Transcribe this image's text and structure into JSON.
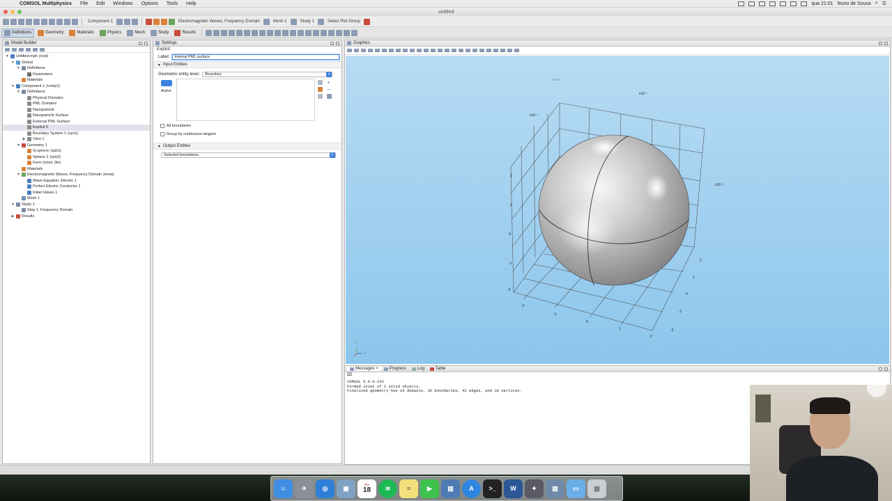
{
  "menubar": {
    "app": "COMSOL Multiphysics",
    "items": [
      "File",
      "Edit",
      "Windows",
      "Options",
      "Tools",
      "Help"
    ],
    "clock": "qua 21:01",
    "user": "Nuno de Sousa"
  },
  "window": {
    "title": "untitled"
  },
  "toolbar1": {
    "component": "Component 1",
    "physics": "Electromagnetic Waves, Frequency Domain",
    "mesh": "Mesh 1",
    "study": "Study 1",
    "plot_group": "Select Plot Group"
  },
  "toolbar2": {
    "tabs": [
      "Definitions",
      "Geometry",
      "Materials",
      "Physics",
      "Mesh",
      "Study",
      "Results"
    ]
  },
  "model_builder": {
    "title": "Model Builder",
    "nodes": [
      {
        "label": "Untitled.mph",
        "tag": "(root)",
        "level": 0,
        "tw": "▼",
        "color": "#4a7fc1"
      },
      {
        "label": "Global",
        "tag": "",
        "level": 1,
        "tw": "▼",
        "color": "#5a9bd5"
      },
      {
        "label": "Definitions",
        "tag": "",
        "level": 2,
        "tw": "▼",
        "color": "#7a8aa0"
      },
      {
        "label": "Parameters",
        "tag": "",
        "level": 3,
        "tw": "",
        "color": "#6b6b6b"
      },
      {
        "label": "Materials",
        "tag": "",
        "level": 2,
        "tw": "",
        "color": "#d9823b"
      },
      {
        "label": "Component 1",
        "tag": "(comp1)",
        "level": 1,
        "tw": "▼",
        "color": "#4a7fc1"
      },
      {
        "label": "Definitions",
        "tag": "",
        "level": 2,
        "tw": "▼",
        "color": "#7a8aa0"
      },
      {
        "label": "Physical Domains",
        "tag": "",
        "level": 3,
        "tw": "",
        "color": "#8a8a8a"
      },
      {
        "label": "PML Domains",
        "tag": "",
        "level": 3,
        "tw": "",
        "color": "#8a8a8a"
      },
      {
        "label": "Nanoparticle",
        "tag": "",
        "level": 3,
        "tw": "",
        "color": "#8a8a8a"
      },
      {
        "label": "Nanoparticle Surface",
        "tag": "",
        "level": 3,
        "tw": "",
        "color": "#8a8a8a"
      },
      {
        "label": "External PML Surface",
        "tag": "",
        "level": 3,
        "tw": "",
        "color": "#8a8a8a"
      },
      {
        "label": "Explicit 5",
        "tag": "",
        "level": 3,
        "tw": "",
        "color": "#8a8a8a",
        "selected": true
      },
      {
        "label": "Boundary System 1",
        "tag": "(sys1)",
        "level": 3,
        "tw": "",
        "color": "#8a8a8a"
      },
      {
        "label": "View 1",
        "tag": "",
        "level": 3,
        "tw": "▶",
        "color": "#8a8a8a"
      },
      {
        "label": "Geometry 1",
        "tag": "",
        "level": 2,
        "tw": "▼",
        "color": "#c84b3c"
      },
      {
        "label": "Si sphere",
        "tag": "(sph1)",
        "level": 3,
        "tw": "",
        "color": "#d9823b"
      },
      {
        "label": "Sphere 2",
        "tag": "(sph2)",
        "level": 3,
        "tw": "",
        "color": "#d9823b"
      },
      {
        "label": "Form Union",
        "tag": "(fin)",
        "level": 3,
        "tw": "",
        "color": "#d9823b"
      },
      {
        "label": "Materials",
        "tag": "",
        "level": 2,
        "tw": "",
        "color": "#d9823b"
      },
      {
        "label": "Electromagnetic Waves, Frequency Domain",
        "tag": "(emw)",
        "level": 2,
        "tw": "▼",
        "color": "#6aa35a"
      },
      {
        "label": "Wave Equation, Electric 1",
        "tag": "",
        "level": 3,
        "tw": "",
        "color": "#4a7fc1"
      },
      {
        "label": "Perfect Electric Conductor 1",
        "tag": "",
        "level": 3,
        "tw": "",
        "color": "#4a7fc1"
      },
      {
        "label": "Initial Values 1",
        "tag": "",
        "level": 3,
        "tw": "",
        "color": "#4a7fc1"
      },
      {
        "label": "Mesh 1",
        "tag": "",
        "level": 2,
        "tw": "",
        "color": "#6b8fb3"
      },
      {
        "label": "Study 1",
        "tag": "",
        "level": 1,
        "tw": "▼",
        "color": "#7a8aa0"
      },
      {
        "label": "Step 1: Frequency Domain",
        "tag": "",
        "level": 2,
        "tw": "",
        "color": "#7a8aa0"
      },
      {
        "label": "Results",
        "tag": "",
        "level": 1,
        "tw": "▶",
        "color": "#c84b3c"
      }
    ]
  },
  "settings": {
    "title": "Settings",
    "subtitle": "Explicit",
    "label_caption": "Label:",
    "label_value": "Internal PML surface",
    "input_section": "Input Entities",
    "geom_level_caption": "Geometric entity level:",
    "geom_level_value": "Boundary",
    "active": "Active",
    "all_boundaries": "All boundaries",
    "group_tangent": "Group by continuous tangent",
    "output_section": "Output Entities",
    "output_value": "Selected boundaries"
  },
  "graphics": {
    "title": "Graphics",
    "scale_top": "x10⁻⁷",
    "scale_left": "x10⁻⁷",
    "scale_right": "x10⁻⁷",
    "ticks_left": [
      "2",
      "1",
      "0",
      "-1",
      "-2"
    ],
    "ticks_bottom": [
      "-2",
      "-1",
      "0",
      "1",
      "2"
    ],
    "ticks_right": [
      "2",
      "1",
      "0",
      "-1",
      "-2"
    ],
    "axis_y": "y",
    "axis_z": "z"
  },
  "messages": {
    "tabs": [
      "Messages",
      "Progress",
      "Log",
      "Table"
    ],
    "lines": [
      "COMSOL 5.0.0.243",
      "Formed union of 2 solid objects.",
      "Finalized geometry has 10 domains, 36 boundaries, 42 edges, and 18 vertices."
    ]
  },
  "dock": {
    "calendar_day": "18",
    "calendar_month": "FEV",
    "apps": [
      "finder-icon",
      "launchpad-icon",
      "safari-icon",
      "preview-icon",
      "calendar-icon",
      "spotify-icon",
      "notes-icon",
      "facetime-icon",
      "archive-icon",
      "appstore-icon",
      "terminal-icon",
      "word-icon",
      "imovie-icon",
      "photos-icon",
      "folder-icon",
      "trash-icon"
    ]
  },
  "colors": {
    "accent": "#3b82e0",
    "graphics_bg_top": "#b7dbf3",
    "graphics_bg_bottom": "#8cc6ec",
    "selection": "#dfe4ea"
  }
}
